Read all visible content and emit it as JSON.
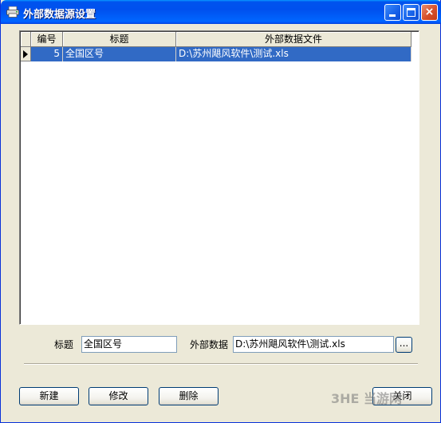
{
  "window": {
    "title": "外部数据源设置",
    "close_glyph": "×"
  },
  "grid": {
    "columns": [
      "编号",
      "标题",
      "外部数据文件"
    ],
    "rows": [
      {
        "id": "5",
        "title": "全国区号",
        "file": "D:\\苏州飓风软件\\测试.xls"
      }
    ]
  },
  "form": {
    "title_label": "标题",
    "title_value": "全国区号",
    "ext_label": "外部数据",
    "ext_value": "D:\\苏州飓风软件\\测试.xls",
    "browse_label": "..."
  },
  "buttons": {
    "new": "新建",
    "edit": "修改",
    "delete": "删除",
    "close": "关闭"
  },
  "watermark": "3HE 当游网",
  "colors": {
    "titlebar": "#0054e3",
    "selection": "#316ac5",
    "face": "#ece9d8"
  }
}
